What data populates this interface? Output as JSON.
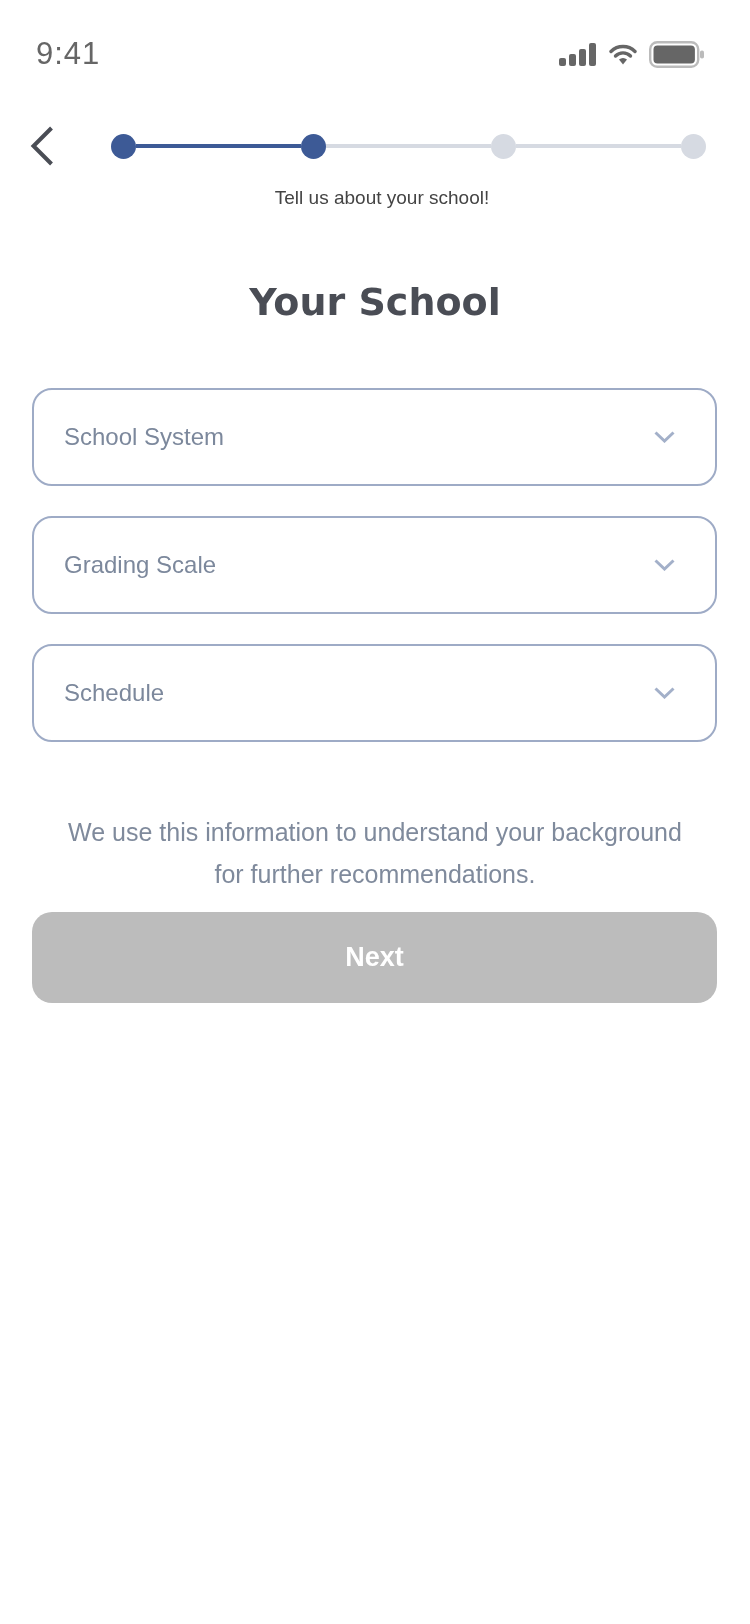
{
  "status_bar": {
    "time": "9:41"
  },
  "header": {
    "steps": [
      {
        "completed": true
      },
      {
        "completed": true
      },
      {
        "completed": false
      },
      {
        "completed": false
      }
    ],
    "caption": "Tell us about your school!"
  },
  "title": "Your School",
  "fields": [
    {
      "placeholder": "School System"
    },
    {
      "placeholder": "Grading Scale"
    },
    {
      "placeholder": "Schedule"
    }
  ],
  "note": "We use this information to understand your background for further recommendations.",
  "next_button": {
    "label": "Next",
    "disabled": true
  }
}
